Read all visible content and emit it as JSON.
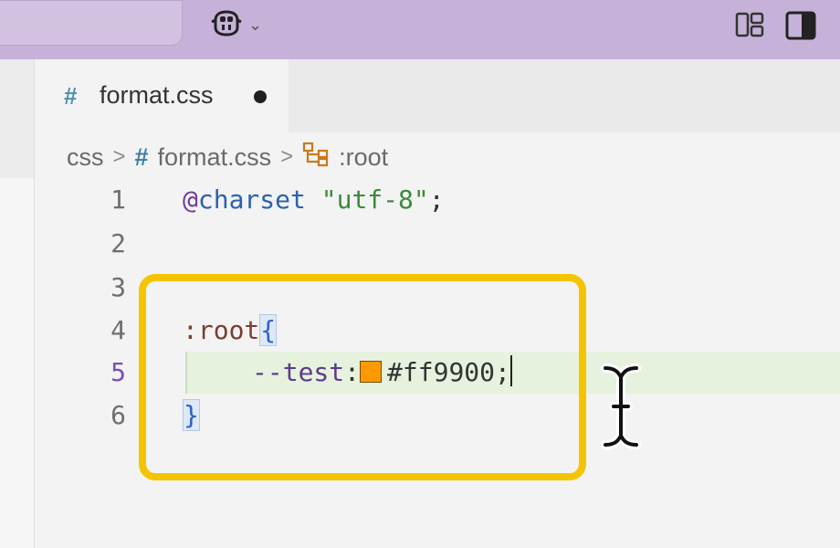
{
  "titlebar": {
    "copilot_icon": "copilot-icon",
    "chevron_icon": "chevron-down-icon",
    "layout_icon": "customize-layout-icon",
    "panel_icon": "toggle-secondary-sidebar-icon"
  },
  "tabs": [
    {
      "icon": "#",
      "label": "format.css",
      "modified": true
    }
  ],
  "breadcrumb": {
    "root": "css",
    "file_icon": "#",
    "file": "format.css",
    "symbol_icon": "symbol-class-icon",
    "symbol": ":root"
  },
  "editor": {
    "active_line": 5,
    "lines": [
      {
        "number": "1"
      },
      {
        "number": "2"
      },
      {
        "number": "3"
      },
      {
        "number": "4"
      },
      {
        "number": "5"
      },
      {
        "number": "6"
      }
    ],
    "code": {
      "l1_at": "@",
      "l1_keyword": "charset",
      "l1_space": " ",
      "l1_string": "\"utf-8\"",
      "l1_semicolon": ";",
      "l4_selector": ":root",
      "l4_brace": "{",
      "l5_property": "--test",
      "l5_colon": ":",
      "l5_value": "#ff9900",
      "l5_semicolon": ";",
      "l6_brace": "}"
    },
    "swatch_color": "#ff9900"
  },
  "colors": {
    "titlebar": "#c6b2d8",
    "highlight_box": "#f5c400",
    "active_line": "#e6f2dd"
  }
}
